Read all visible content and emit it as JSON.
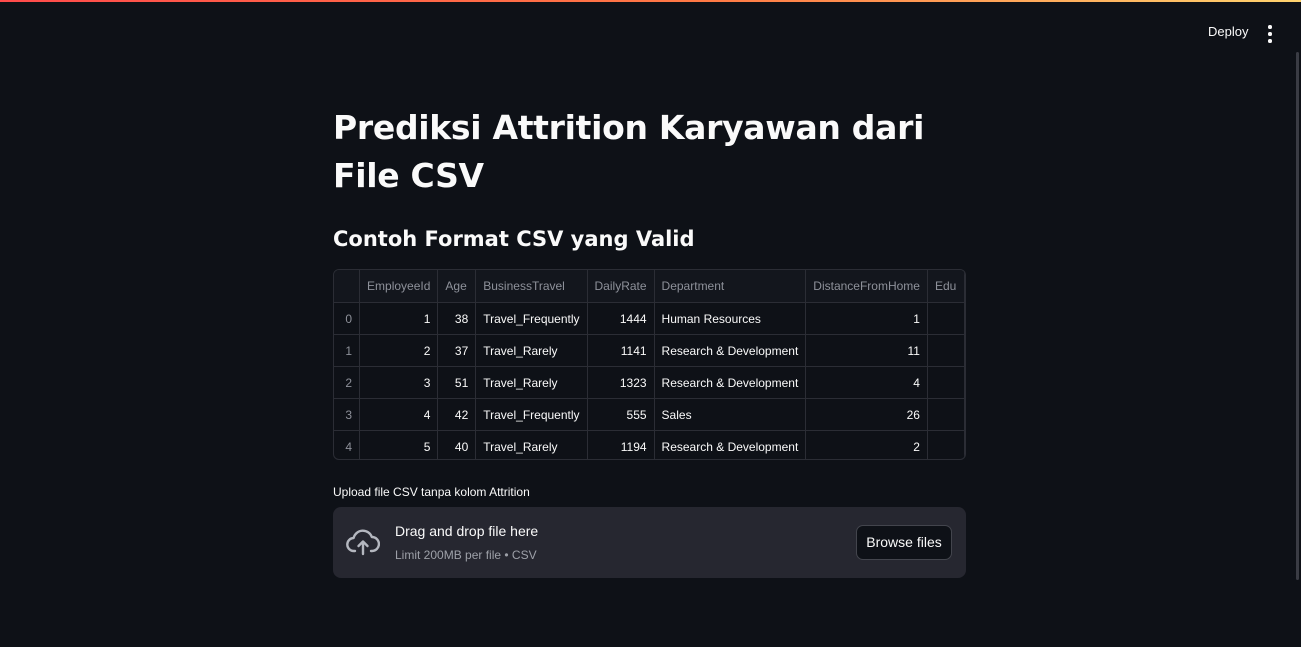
{
  "header": {
    "deploy_label": "Deploy",
    "menu_icon": "vertical-ellipsis-icon"
  },
  "main": {
    "title": "Prediksi Attrition Karyawan dari File CSV",
    "subtitle": "Contoh Format CSV yang Valid"
  },
  "table": {
    "columns": [
      "",
      "EmployeeId",
      "Age",
      "BusinessTravel",
      "DailyRate",
      "Department",
      "DistanceFromHome",
      "Edu"
    ],
    "rows": [
      [
        "0",
        "1",
        "38",
        "Travel_Frequently",
        "1444",
        "Human Resources",
        "1",
        ""
      ],
      [
        "1",
        "2",
        "37",
        "Travel_Rarely",
        "1141",
        "Research & Development",
        "11",
        ""
      ],
      [
        "2",
        "3",
        "51",
        "Travel_Rarely",
        "1323",
        "Research & Development",
        "4",
        ""
      ],
      [
        "3",
        "4",
        "42",
        "Travel_Frequently",
        "555",
        "Sales",
        "26",
        ""
      ],
      [
        "4",
        "5",
        "40",
        "Travel_Rarely",
        "1194",
        "Research & Development",
        "2",
        ""
      ]
    ]
  },
  "upload": {
    "label": "Upload file CSV tanpa kolom Attrition",
    "dropzone_title": "Drag and drop file here",
    "dropzone_subtitle": "Limit 200MB per file • CSV",
    "browse_label": "Browse files",
    "icon": "cloud-upload-icon"
  },
  "colors": {
    "background": "#0e1117",
    "dropzone": "#262730",
    "accent_start": "#ff4b4b",
    "accent_end": "#ffd36e"
  }
}
